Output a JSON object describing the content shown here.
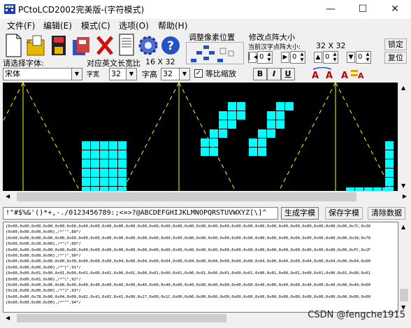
{
  "window": {
    "title": "PCtoLCD2002完美版-(字符模式)",
    "minimize_label": "—",
    "maximize_label": "☐",
    "close_label": "✕"
  },
  "menu": [
    "文件(F)",
    "编辑(E)",
    "模式(C)",
    "选项(O)",
    "帮助(H)"
  ],
  "toolbar": {
    "icons": [
      "new-file-icon",
      "open-folder-icon",
      "save-disk-icon",
      "stack-disk-icon",
      "delete-x-icon",
      "document-icon",
      "gear-icon",
      "help-icon"
    ]
  },
  "adjust": {
    "title": "调整像素位置"
  },
  "resize": {
    "title": "修改点阵大小",
    "subtitle": "当前汉字点阵大小:",
    "size_value": "32 X 32",
    "lock_button": "锁定",
    "restore_button": "复位",
    "spinners": [
      "0",
      "0",
      "0",
      "0"
    ]
  },
  "font_select": {
    "label": "请选择字体:",
    "font_value": "宋体",
    "width_label": "对应英文长宽比",
    "width_ratio": "16 X 32",
    "char_width_label": "字宽",
    "char_width": "32",
    "char_height_label": "字高",
    "char_height": "32",
    "proportional_label": "等比缩放",
    "proportional_checked": true
  },
  "format_buttons": [
    "B",
    "I",
    "U"
  ],
  "charset": "!\"#$%&'()*+,-./0123456789:;<=>?@ABCDEFGHIJKLMNOPQRSTUVWXYZ[\\]^",
  "actions": {
    "generate": "生成字模",
    "save": "保存字模",
    "clear": "清除数据"
  },
  "output_lines": [
    "{0x00,0x00,0x00,0x00,0x00,0x00,0x00,0x00,0x00,0x00,0x00,0x00,0x00,0x00,0x00,0x00,0x00,0x00,0x00,0x00,0x00,0x00,0x00,0x00,0x00,0x00,0x00,0x00,0x00,0x7C,0x38",
    "{0x00,0x00,0x00,0x00},/*\"'\",88*/",
    "{0x00,0x00,0x00,0x00,0x00,0x00,0x00,0x00,0x00,0x00,0x00,0x00,0x00,0x00,0x00,0x00,0x00,0x00,0x00,0x00,0x00,0x00,0x00,0x00,0x00,0x00,0x00,0x00,0x00,0x38,0x70",
    "{0x00,0x00,0x30,0x00},/*\"(\",89*/",
    "{0x00,0x00,0x00,0x00,0x00,0x00,0x00,0x00,0x00,0x00,0x00,0x00,0x00,0x00,0x00,0x00,0x00,0x00,0x00,0x00,0x00,0x00,0x00,0x00,0x00,0x00,0x00,0x00,0x00,0xFC,0x1F",
    "{0x00,0x00,0x00,0x00},/*\")\",90*/",
    "{0x00,0x00,0x00,0x00,0x00,0x30,0x00,0x08,0x00,0x04,0x00,0x04,0x00,0x04,0x00,0x04,0x00,0x04,0x00,0x04,0x00,0x04,0x00,0x04,0x00,0x04,0x00,0x04,0x00,0x04,0x00",
    "{0x00,0x00,0x00,0x00},/*\"[\",91*/",
    "{0x00,0x00,0x01,0x00,0x01,0x00,0x01,0x00,0x01,0x00,0x01,0x00,0x01,0x00,0x01,0x00,0x01,0x00,0x01,0x00,0x01,0x00,0x01,0x00,0x01,0x00,0x01,0x00,0x01,0x00,0x01",
    "{0x00,0x00,0x01,0x00},/*\"\\\",92*/",
    "{0x00,0x00,0x00,0x00,0x00,0x40,0x00,0x40,0x00,0x40,0x00,0x40,0x00,0x40,0x00,0x40,0x00,0x40,0x00,0x40,0x00,0x40,0x00,0x40,0x00,0x40,0x00,0x40,0x00,0x40,0x00",
    "{0x18,0x00,0x00,0x00},/*\"]\",93*/",
    "{0x00,0x00,0x78,0x00,0x04,0x00,0x82,0x41,0x02,0x41,0x00,0x27,0x00,0x1C,0x00,0x00,0x00,0x00,0x00,0x00,0x00,0x00,0x00,0x00,0x00,0x00,0x00,0x00,0x00,0x00,0x00",
    "{0x00,0x00,0x00,0x00},/*\"^\",94*/"
  ],
  "watermark": "CSDN @fengche1915",
  "colors": {
    "pixel": "#00ffff",
    "canvas_bg": "#000000",
    "guide_line": "#ffff00"
  }
}
